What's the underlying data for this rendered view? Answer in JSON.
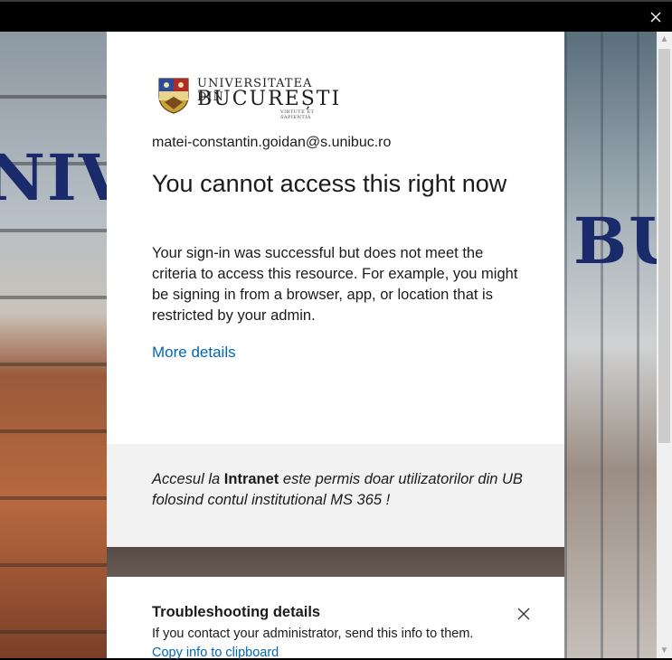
{
  "window": {
    "close_icon": "close-icon"
  },
  "logo": {
    "line1": "UNIVERSITATEA DIN",
    "line2": "BUCUREȘTI",
    "motto": "VIRTUTE ET SAPIENTIA"
  },
  "background": {
    "sign_left": "NIV",
    "sign_right": "BUC"
  },
  "signin": {
    "email": "matei-constantin.goidan@s.unibuc.ro",
    "title": "You cannot access this right now",
    "description": "Your sign-in was successful but does not meet the criteria to access this resource. For example, you might be signing in from a browser, app, or location that is restricted by your admin.",
    "more_details": "More details"
  },
  "banner": {
    "prefix": "Accesul la ",
    "bold": "Intranet",
    "suffix": " este permis doar utilizatorilor din UB folosind contul institutional MS 365 !"
  },
  "troubleshooting": {
    "title": "Troubleshooting details",
    "subtitle": "If you contact your administrator, send this info to them.",
    "copy_link": "Copy info to clipboard"
  },
  "colors": {
    "link": "#0067b8",
    "banner_bg": "#f2f2f2",
    "text": "#1b1b1b"
  }
}
